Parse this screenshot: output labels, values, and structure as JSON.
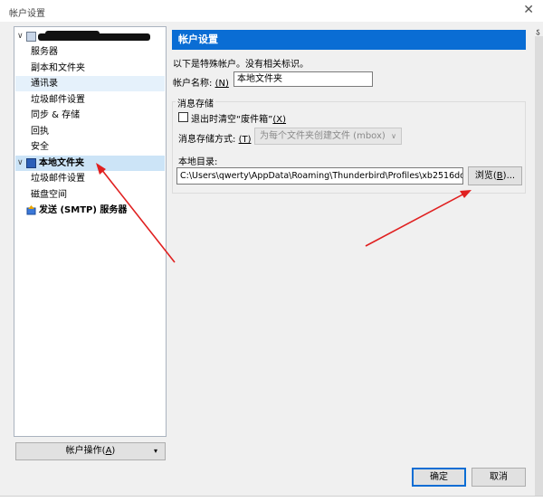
{
  "window": {
    "title": "帐户设置"
  },
  "tree": {
    "items": [
      {
        "label": "服务器"
      },
      {
        "label": "副本和文件夹"
      },
      {
        "label": "通讯录"
      },
      {
        "label": "垃圾邮件设置"
      },
      {
        "label": "同步 & 存储"
      },
      {
        "label": "回执"
      },
      {
        "label": "安全"
      }
    ],
    "local_folder": {
      "label": "本地文件夹",
      "children": [
        {
          "label": "垃圾邮件设置"
        },
        {
          "label": "磁盘空间"
        }
      ]
    },
    "smtp": {
      "label": "发送 (SMTP) 服务器"
    }
  },
  "account_actions": {
    "label": "帐户操作(",
    "key": "A",
    "suffix": ")"
  },
  "panel": {
    "header": "帐户设置",
    "description": "以下是特殊帐户。没有相关标识。",
    "account_name_label": "帐户名称:",
    "account_name_key": "(N)",
    "account_name_value": "本地文件夹",
    "storage_title": "消息存储",
    "empty_trash_label": "退出时清空“废件箱”",
    "empty_trash_key": "(X)",
    "storage_type_label": "消息存储方式:",
    "storage_type_key": "(T)",
    "storage_type_value": "为每个文件夹创建文件 (mbox)",
    "local_dir_label": "本地目录:",
    "local_dir_value": "C:\\Users\\qwerty\\AppData\\Roaming\\Thunderbird\\Profiles\\xb2516do",
    "browse_label": "浏览(",
    "browse_key": "B",
    "browse_suffix": ")..."
  },
  "footer": {
    "ok_label": "确定",
    "cancel_label": "取消"
  },
  "colors": {
    "header_bg": "#0a6dd4",
    "arrow": "#e02020",
    "selection": "#cce4f7"
  }
}
